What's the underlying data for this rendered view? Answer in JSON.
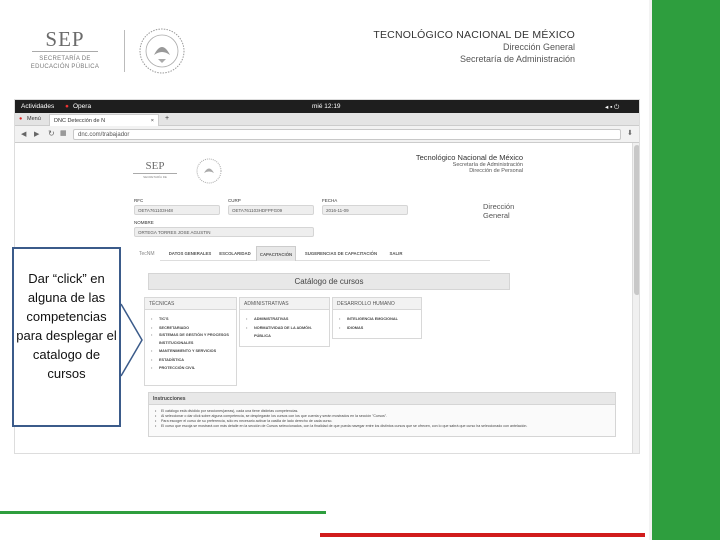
{
  "slide_header": {
    "sep_logo_text": "SEP",
    "sep_subtitle_1": "SECRETARÍA DE",
    "sep_subtitle_2": "EDUCACIÓN PÚBLICA",
    "title": "TECNOLÓGICO NACIONAL DE MÉXICO",
    "line2": "Dirección General",
    "line3": "Secretaría de Administración"
  },
  "os_bar": {
    "activities": "Actividades",
    "browser": "Opera",
    "clock": "mié 12:19"
  },
  "browser": {
    "menu_label": "Menú",
    "tab_title": "DNC Detección de N",
    "url": "dnc.com/trabajador"
  },
  "app": {
    "institution": "Tecnológico Nacional de México",
    "sub1": "Secretaría de Administración",
    "sub2": "Dirección de Personal",
    "dg_line1": "Dirección",
    "dg_line2": "General",
    "rfc_label": "RFC",
    "rfc_value": "OETA761103H48",
    "curp_label": "CURP",
    "curp_value": "OETA761103HDFPFG09",
    "fecha_label": "FECHA",
    "fecha_value": "2016-11-09",
    "nombre_label": "NOMBRE",
    "nombre_value": "ORTEGA TORRES JOSE AGUSTIN",
    "brand": "TecNM",
    "tabs": [
      "DATOS GENERALES",
      "ESCOLARIDAD",
      "CAPACITACIÓN",
      "SUGERENCIAS DE CAPACITACIÓN",
      "SALIR"
    ],
    "active_tab": "CAPACITACIÓN",
    "catalog_title": "Catálogo de cursos",
    "columns": [
      {
        "header": "TÉCNICAS",
        "items": [
          "TIC'S",
          "SECRETARIADO",
          "SISTEMAS DE GESTIÓN Y PROCESOS INSTITUCIONALES",
          "MANTENIMIENTO Y SERVICIOS",
          "ESTADÍSTICA",
          "PROTECCIÓN CIVIL"
        ]
      },
      {
        "header": "ADMINISTRATIVAS",
        "items": [
          "ADMINISTRATIVAS",
          "NORMATIVIDAD DE LA ADMÓN. PÚBLICA"
        ]
      },
      {
        "header": "DESARROLLO HUMANO",
        "items": [
          "INTELIGENCIA EMOCIONAL",
          "IDIOMAS"
        ]
      }
    ],
    "instructions_title": "Instrucciones",
    "instructions": [
      "El catálogo está dividido por secciones(areas), cada una tiene distintas competencias.",
      "Al seleccionar o dar click sobre alguna competencia, se desplegarán los cursos con los que cuenta y serán mostrados en la sección \"Cursos\".",
      "Para escoger el curso de su preferencia, sólo es necesario activar la casilla de lado derecho de cada curso.",
      "El curso que escoja se mostrará con más detalle en la sección de Cursos seleccionados, con la finalidad de que pueda navegar entre los distintos cursos que se ofrecen, con lo que sabrá que curso ha seleccionado con antelación."
    ]
  },
  "callout": {
    "text": "Dar “click” en alguna de las competencias para desplegar el catalogo de cursos"
  },
  "colors": {
    "green": "#2e9e3e",
    "red": "#d11c1c",
    "callout_border": "#3b5b8a"
  }
}
